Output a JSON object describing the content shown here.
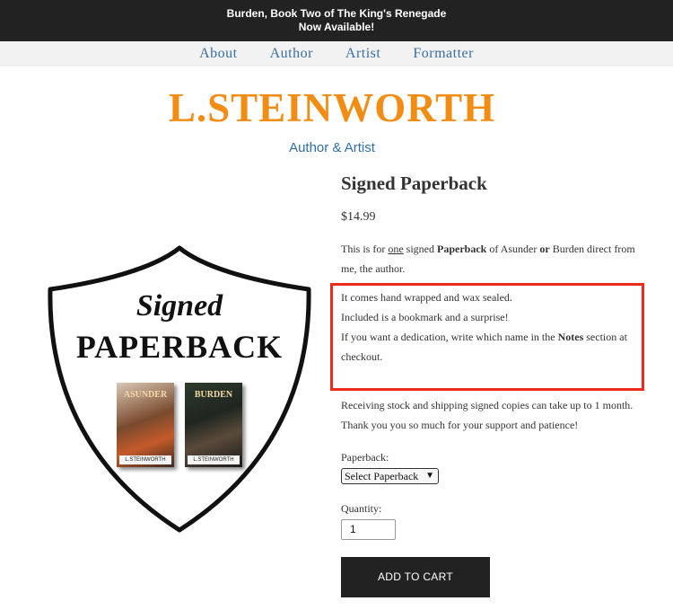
{
  "announcement": {
    "line1": "Burden, Book Two of The King's Renegade",
    "line2": "Now Available!"
  },
  "nav": [
    "About",
    "Author",
    "Artist",
    "Formatter"
  ],
  "brand": {
    "name": "L.STEINWORTH",
    "tagline": "Author & Artist",
    "color": "#f28c13"
  },
  "image": {
    "signed": "Signed",
    "paperback": "PAPERBACK",
    "book1": {
      "title": "ASUNDER",
      "author": "L.STEINWORTH"
    },
    "book2": {
      "title": "BURDEN",
      "author": "L.STEINWORTH"
    }
  },
  "product": {
    "title": "Signed Paperback",
    "price": "$14.99",
    "desc": {
      "a": "This is for ",
      "b": "one",
      "c": " signed ",
      "d": "Paperback",
      "e": " of Asunder ",
      "f": "or",
      "g": " Burden direct from me, the author."
    },
    "wrap_line1": "It comes hand wrapped and wax sealed.",
    "wrap_line2": "Included is a bookmark and a surprise!",
    "dedication": {
      "a": "If you want a dedication, write which name in the ",
      "b": "Notes",
      "c": " section at checkout."
    },
    "shipping_note": "Receiving stock and shipping signed copies can take up to 1 month. Thank you you so much for your support and patience!",
    "paperback_label": "Paperback:",
    "paperback_select": "Select Paperback",
    "quantity_label": "Quantity:",
    "quantity_value": "1",
    "add_to_cart": "ADD TO CART"
  },
  "highlight_color": "#ee2a1a"
}
